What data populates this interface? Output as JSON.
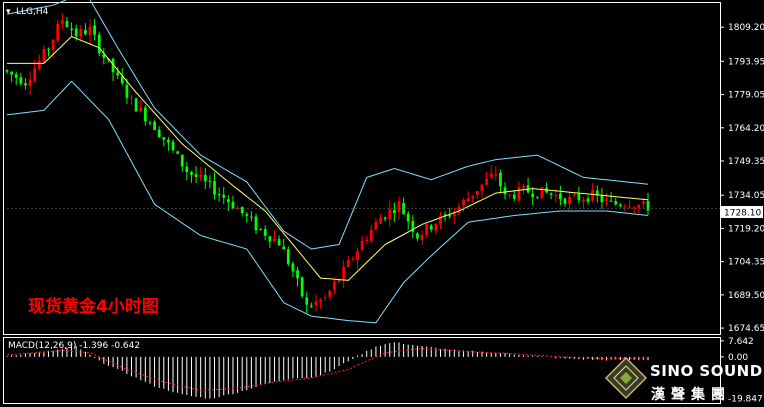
{
  "header": {
    "symbol_label": "LLG,H4"
  },
  "overlay": {
    "title_cn": "现货黄金4小时图"
  },
  "macd": {
    "label": "MACD(12,26,9) -1.396 -0.642"
  },
  "brand": {
    "name": "SINO SOUND",
    "name_cn": "漢聲集團"
  },
  "colors": {
    "background": "#000000",
    "grid": "#ffffff",
    "bull": "#ff0000",
    "bear": "#00ff00",
    "bollinger": "#7ee0ff",
    "ma": "#ffff66",
    "macd_hist": "#ffffff",
    "macd_signal": "#ff2020",
    "overlay_title": "#ff0000"
  },
  "chart_data": {
    "type": "candlestick",
    "price_axis": {
      "min": 1672,
      "max": 1820,
      "ticks": [
        "1809.20",
        "1793.95",
        "1779.05",
        "1764.20",
        "1749.35",
        "1734.05",
        "1719.20",
        "1704.35",
        "1689.50",
        "1674.65"
      ]
    },
    "current_price": "1728.10",
    "macd_axis": {
      "min": -22,
      "max": 9,
      "ticks": [
        "7.642",
        "0.00",
        "-19.847"
      ]
    },
    "price_path": [
      [
        0,
        1790
      ],
      [
        5,
        1785
      ],
      [
        10,
        1800
      ],
      [
        13,
        1813
      ],
      [
        16,
        1806
      ],
      [
        19,
        1808
      ],
      [
        22,
        1796
      ],
      [
        28,
        1776
      ],
      [
        33,
        1765
      ],
      [
        40,
        1745
      ],
      [
        45,
        1738
      ],
      [
        50,
        1730
      ],
      [
        55,
        1720
      ],
      [
        60,
        1713
      ],
      [
        63,
        1700
      ],
      [
        66,
        1684
      ],
      [
        70,
        1688
      ],
      [
        74,
        1700
      ],
      [
        78,
        1713
      ],
      [
        82,
        1724
      ],
      [
        86,
        1730
      ],
      [
        90,
        1716
      ],
      [
        94,
        1722
      ],
      [
        98,
        1727
      ],
      [
        102,
        1735
      ],
      [
        107,
        1744
      ],
      [
        109,
        1733
      ],
      [
        113,
        1736
      ],
      [
        118,
        1735
      ],
      [
        123,
        1732
      ],
      [
        128,
        1734
      ],
      [
        132,
        1730
      ],
      [
        136,
        1731
      ],
      [
        139,
        1729
      ]
    ],
    "bb_upper": [
      [
        0,
        1815
      ],
      [
        10,
        1819
      ],
      [
        17,
        1825
      ],
      [
        24,
        1800
      ],
      [
        32,
        1773
      ],
      [
        42,
        1752
      ],
      [
        52,
        1740
      ],
      [
        60,
        1718
      ],
      [
        66,
        1710
      ],
      [
        72,
        1712
      ],
      [
        78,
        1742
      ],
      [
        84,
        1746
      ],
      [
        92,
        1741
      ],
      [
        100,
        1747
      ],
      [
        106,
        1750
      ],
      [
        115,
        1752
      ],
      [
        125,
        1742
      ],
      [
        139,
        1739
      ]
    ],
    "bb_lower": [
      [
        0,
        1770
      ],
      [
        8,
        1772
      ],
      [
        14,
        1785
      ],
      [
        22,
        1768
      ],
      [
        32,
        1730
      ],
      [
        42,
        1716
      ],
      [
        52,
        1710
      ],
      [
        60,
        1686
      ],
      [
        66,
        1680
      ],
      [
        74,
        1678
      ],
      [
        80,
        1677
      ],
      [
        86,
        1695
      ],
      [
        92,
        1707
      ],
      [
        100,
        1722
      ],
      [
        110,
        1725
      ],
      [
        120,
        1727
      ],
      [
        130,
        1727
      ],
      [
        139,
        1725
      ]
    ],
    "ma": [
      [
        0,
        1793
      ],
      [
        8,
        1793
      ],
      [
        14,
        1805
      ],
      [
        20,
        1800
      ],
      [
        28,
        1780
      ],
      [
        38,
        1757
      ],
      [
        48,
        1740
      ],
      [
        56,
        1727
      ],
      [
        62,
        1712
      ],
      [
        68,
        1697
      ],
      [
        74,
        1696
      ],
      [
        82,
        1712
      ],
      [
        90,
        1721
      ],
      [
        98,
        1727
      ],
      [
        106,
        1735
      ],
      [
        114,
        1737
      ],
      [
        124,
        1735
      ],
      [
        139,
        1732
      ]
    ],
    "macd_hist_path": [
      [
        0,
        0.5
      ],
      [
        10,
        3
      ],
      [
        15,
        5
      ],
      [
        20,
        -2
      ],
      [
        26,
        -8
      ],
      [
        32,
        -14
      ],
      [
        38,
        -18
      ],
      [
        44,
        -20
      ],
      [
        50,
        -17
      ],
      [
        56,
        -13
      ],
      [
        62,
        -10
      ],
      [
        66,
        -10
      ],
      [
        70,
        -7
      ],
      [
        74,
        -2
      ],
      [
        80,
        5
      ],
      [
        84,
        7
      ],
      [
        90,
        5
      ],
      [
        98,
        3
      ],
      [
        106,
        2
      ],
      [
        114,
        0.5
      ],
      [
        122,
        -1
      ],
      [
        130,
        -1.5
      ],
      [
        139,
        -1.4
      ]
    ],
    "macd_signal_path": [
      [
        0,
        1
      ],
      [
        12,
        3
      ],
      [
        18,
        2
      ],
      [
        26,
        -6
      ],
      [
        34,
        -12
      ],
      [
        42,
        -16
      ],
      [
        50,
        -15
      ],
      [
        58,
        -12
      ],
      [
        66,
        -10
      ],
      [
        74,
        -6
      ],
      [
        82,
        2
      ],
      [
        90,
        4
      ],
      [
        100,
        2.5
      ],
      [
        110,
        1.5
      ],
      [
        120,
        0
      ],
      [
        130,
        -0.8
      ],
      [
        139,
        -0.6
      ]
    ],
    "candle_count": 140
  }
}
